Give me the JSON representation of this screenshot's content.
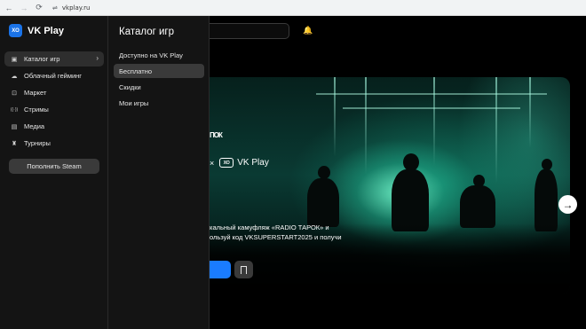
{
  "browser": {
    "url": "vkplay.ru",
    "back_icon": "←",
    "forward_icon": "→",
    "reload_icon": "⟳",
    "site_settings_icon": "⇌"
  },
  "brand": {
    "logo_mark": "ХО",
    "name": "VK Play",
    "accent": "#1a73e8"
  },
  "sidebar": {
    "items": [
      {
        "label": "Каталог игр",
        "icon": "gamepad-icon",
        "glyph": "▣",
        "active": true
      },
      {
        "label": "Облачный гейминг",
        "icon": "cloud-icon",
        "glyph": "☁",
        "active": false
      },
      {
        "label": "Маркет",
        "icon": "bag-icon",
        "glyph": "⊡",
        "active": false
      },
      {
        "label": "Стримы",
        "icon": "broadcast-icon",
        "glyph": "((·))",
        "active": false
      },
      {
        "label": "Медиа",
        "icon": "news-icon",
        "glyph": "▤",
        "active": false
      },
      {
        "label": "Турниры",
        "icon": "trophy-icon",
        "glyph": "♜",
        "active": false
      }
    ],
    "chevron": "›",
    "steam_button": "Пополнить Steam"
  },
  "catalog_menu": {
    "title": "Каталог игр",
    "items": [
      {
        "label": "Доступно на VK Play",
        "active": false
      },
      {
        "label": "Бесплатно",
        "active": true
      },
      {
        "label": "Скидки",
        "active": false
      },
      {
        "label": "Мои игры",
        "active": false
      }
    ]
  },
  "header": {
    "bell_icon": "🔔"
  },
  "banner": {
    "brand_fragment": "ПОК",
    "collab_separator": "×",
    "collab_mark": "ХО",
    "collab_name": "VK Play",
    "promo_line1": "кальный камуфляж «RADIO ТАРОК» и",
    "promo_line2": "ользуй код VKSUPERSTART2025 и получи",
    "cta_color": "#1a7cff",
    "next_icon": "→"
  }
}
